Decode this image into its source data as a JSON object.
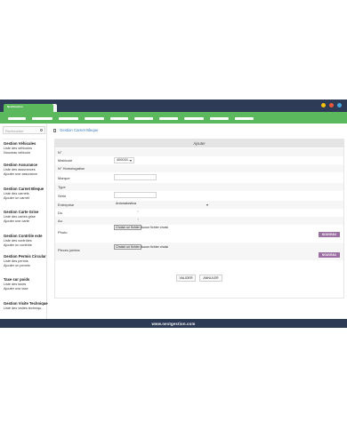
{
  "browser": {
    "tab_label": "NextGestion",
    "dot_colors": [
      "#f4c20d",
      "#e8583c",
      "#44a9e0"
    ]
  },
  "colors": {
    "navy": "#2e3b56",
    "green": "#5cb85c",
    "purple": "#9b6fa1",
    "link": "#3a7bbf"
  },
  "sidebar": {
    "search_placeholder": "Rechercher",
    "sections": [
      {
        "title": "Gestion Véhicules",
        "items": [
          "Liste des véhicules",
          "Nouveau véhicule"
        ]
      },
      {
        "title": "Gestion Assurance",
        "items": [
          "Liste des assurances",
          "Ajouter une assurance"
        ]
      },
      {
        "title": "Gestion Carnet Bleque",
        "items": [
          "Liste des carnets",
          "Ajouter un carnet"
        ]
      },
      {
        "title": "Gestion Carte Grise",
        "items": [
          "Liste des cartes grise",
          "Ajouter une carte"
        ]
      },
      {
        "title": "Gestion Contrôle exte",
        "items": [
          "Liste des contrôles",
          "Ajouter un contrôle"
        ]
      },
      {
        "title": "Gestion Permis Circular",
        "items": [
          "Liste des permis",
          "Ajouter un permis"
        ]
      },
      {
        "title": "Taxe sur poids",
        "items": [
          "Liste des taxes",
          "Ajouter une taxe"
        ]
      },
      {
        "title": "Gestion Visite Technique",
        "items": [
          "Liste des visites techniqu..."
        ]
      }
    ]
  },
  "main": {
    "breadcrumb": "Gestion Carnet Bleque",
    "panel_title": "Ajouter",
    "fields": {
      "numero": "N°",
      "matricule": "Matricule",
      "matricule_value": "400015...",
      "homologation": "N° Homologation",
      "marque": "Marque",
      "type": "Type",
      "serie": "Série",
      "entreprise": "Entreprise",
      "entreprise_value": "Antonatostica",
      "du": "Du",
      "au": "Au",
      "photo": "Photo",
      "pieces": "Pieces jointes"
    },
    "file": {
      "button": "Choisir un fichier",
      "none": "Aucun fichier choisi"
    },
    "add_more": "NOUVEAU",
    "validate": "VALIDER",
    "cancel": "ANNULER"
  },
  "footer": {
    "text": "www.nextgestion.com"
  }
}
